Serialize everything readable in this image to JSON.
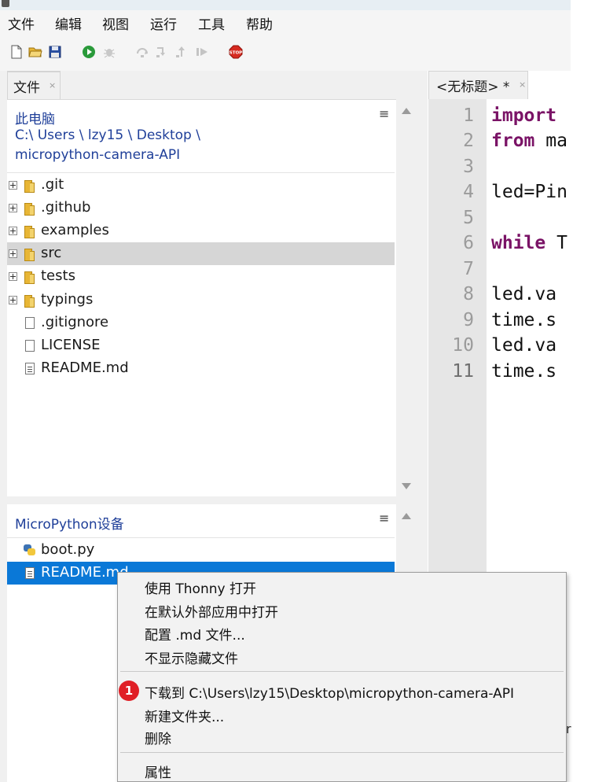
{
  "menubar": {
    "items": [
      "文件",
      "编辑",
      "视图",
      "运行",
      "工具",
      "帮助"
    ]
  },
  "toolbar": {
    "icons": [
      "new-file-icon",
      "open-folder-icon",
      "save-icon",
      "run-icon",
      "debug-icon",
      "step-over-icon",
      "step-into-icon",
      "step-out-icon",
      "resume-icon",
      "stop-icon"
    ],
    "colors": {
      "run": "#2a9a3a",
      "stop": "#d62a20"
    }
  },
  "files_tab": {
    "label": "文件"
  },
  "local_panel": {
    "title": "此电脑",
    "path_line1": "C:\\ Users \\ lzy15 \\ Desktop \\",
    "path_line2": "micropython-camera-API",
    "items": [
      {
        "name": ".git",
        "type": "folder"
      },
      {
        "name": ".github",
        "type": "folder"
      },
      {
        "name": "examples",
        "type": "folder"
      },
      {
        "name": "src",
        "type": "folder",
        "selected": true
      },
      {
        "name": "tests",
        "type": "folder"
      },
      {
        "name": "typings",
        "type": "folder"
      },
      {
        "name": ".gitignore",
        "type": "file"
      },
      {
        "name": "LICENSE",
        "type": "file"
      },
      {
        "name": "README.md",
        "type": "text-file"
      }
    ]
  },
  "device_panel": {
    "title": "MicroPython设备",
    "items": [
      {
        "name": "boot.py",
        "type": "python-file"
      },
      {
        "name": "README.md",
        "type": "text-file",
        "selected": true
      }
    ]
  },
  "editor": {
    "tab_label": "<无标题> *",
    "line_numbers": [
      "1",
      "2",
      "3",
      "4",
      "5",
      "6",
      "7",
      "8",
      "9",
      "10",
      "11"
    ],
    "lines": [
      {
        "kw": "import",
        "rest": ""
      },
      {
        "kw": "from",
        "rest": " ma"
      },
      {
        "kw": "",
        "rest": ""
      },
      {
        "kw": "",
        "rest": "led=Pin"
      },
      {
        "kw": "",
        "rest": ""
      },
      {
        "kw": "while",
        "rest": " T"
      },
      {
        "kw": "",
        "rest": ""
      },
      {
        "kw": "",
        "rest": " led.va"
      },
      {
        "kw": "",
        "rest": " time.s"
      },
      {
        "kw": "",
        "rest": " led.va"
      },
      {
        "kw": "",
        "rest": " time.s"
      }
    ]
  },
  "context_menu": {
    "items": [
      "使用 Thonny 打开",
      "在默认外部应用中打开",
      "配置 .md 文件...",
      "不显示隐藏文件",
      "下载到 C:\\Users\\lzy15\\Desktop\\micropython-camera-API",
      "新建文件夹...",
      "删除",
      "属性"
    ],
    "badge": "1",
    "badge_color": "#e01f26"
  },
  "edge_fragment": "r"
}
